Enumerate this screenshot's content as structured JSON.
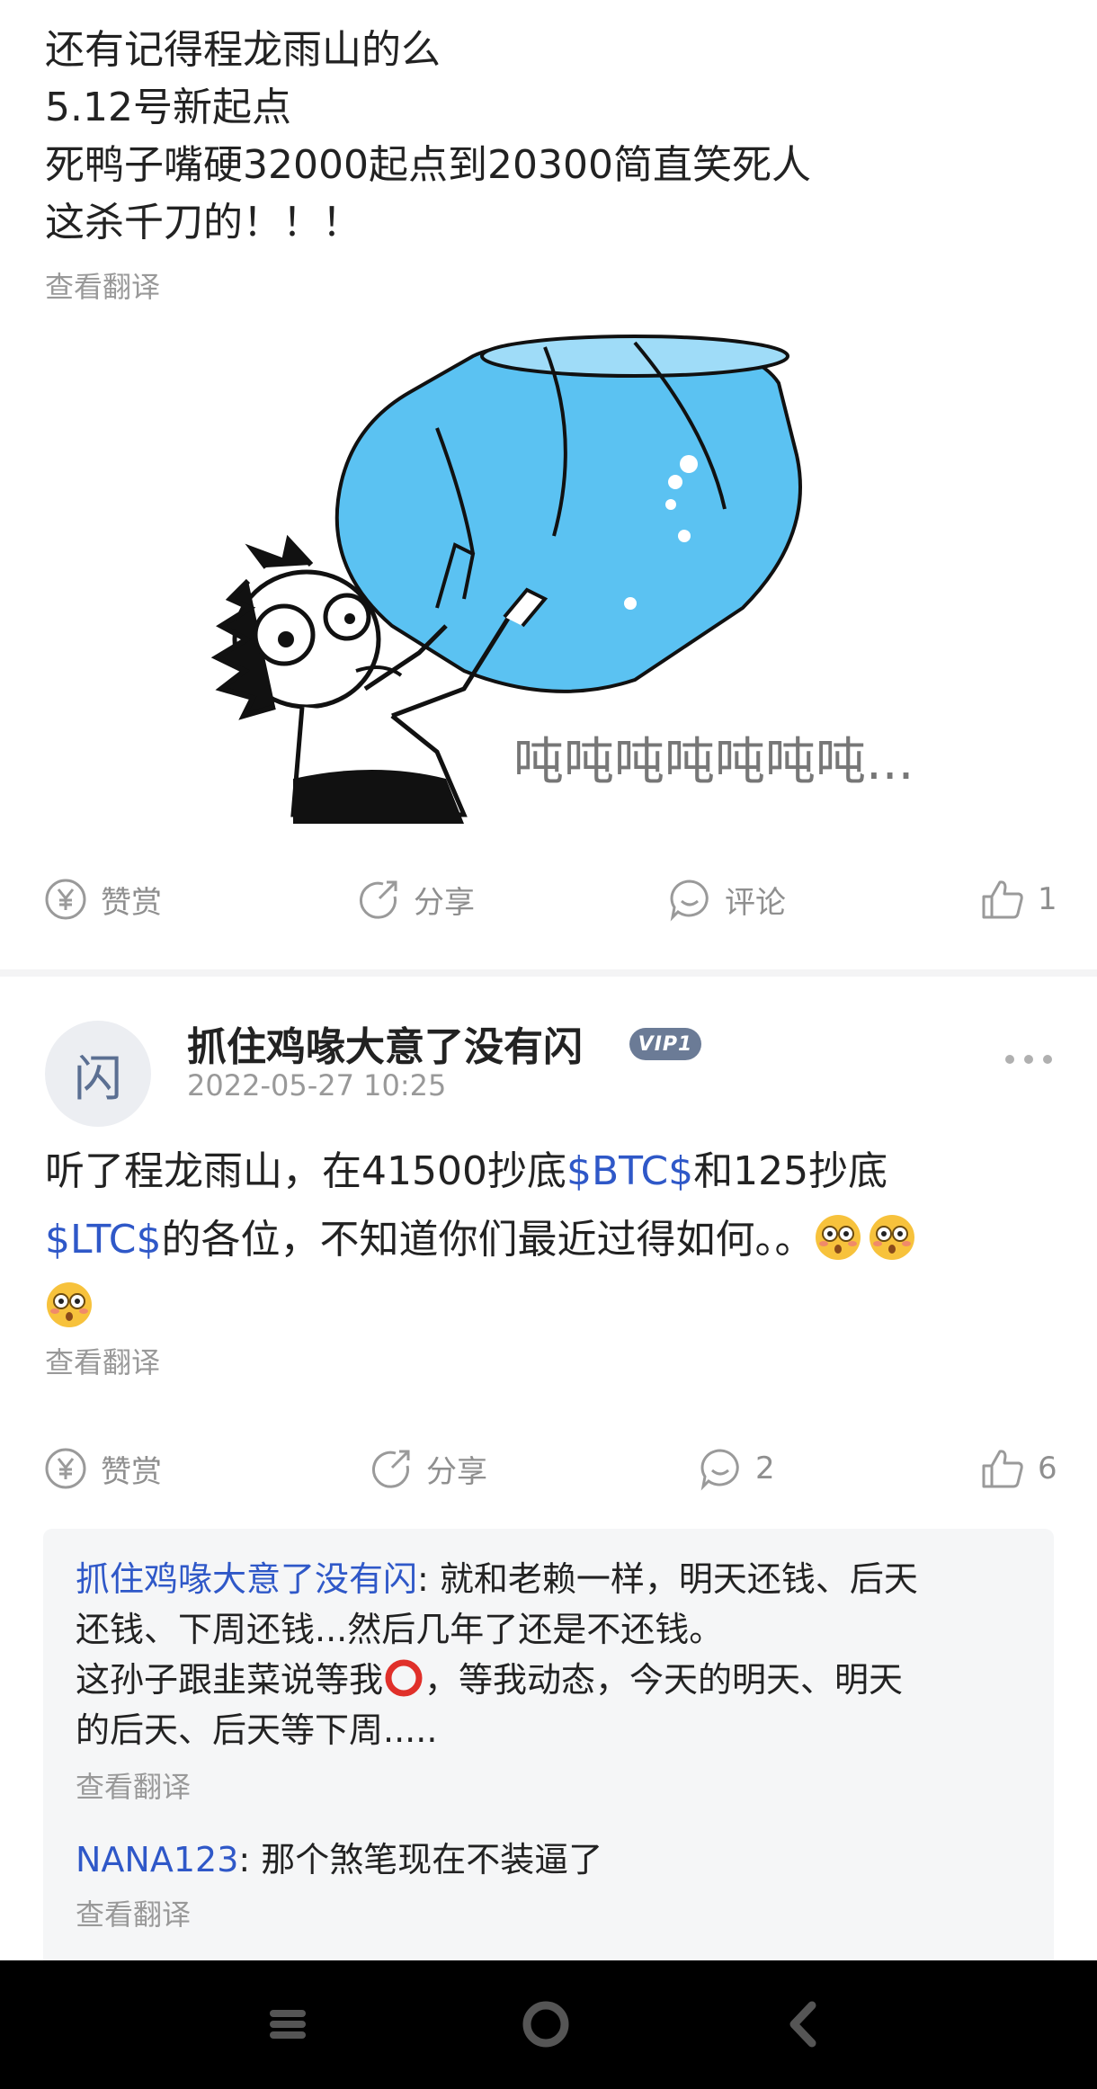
{
  "post1": {
    "lines": [
      "还有记得程龙雨山的么",
      "5.12号新起点",
      "死鸭子嘴硬32000起点到20300简直笑死人",
      "这杀千刀的！！！"
    ],
    "translate": "查看翻译",
    "meme_caption": "吨吨吨吨吨吨吨...",
    "actions": {
      "reward": "赞赏",
      "share": "分享",
      "comment": "评论",
      "like_count": "1"
    }
  },
  "post2": {
    "avatar_char": "闪",
    "username": "抓住鸡喙大意了没有闪",
    "vip_badge": "VIP1",
    "timestamp": "2022-05-27 10:25",
    "body": {
      "p1": "听了程龙雨山，在41500抄底",
      "tag_btc": "$BTC$",
      "p2": "和125抄底",
      "tag_ltc": "$LTC$",
      "p3": "的各位，不知道你们最近过得如何。。"
    },
    "translate": "查看翻译",
    "actions": {
      "reward": "赞赏",
      "share": "分享",
      "comment_count": "2",
      "like_count": "6"
    },
    "comments": [
      {
        "author": "抓住鸡喙大意了没有闪",
        "line1": ": 就和老赖一样，明天还钱、后天",
        "line2": "还钱、下周还钱...然后几年了还是不还钱。",
        "line3a": "这孙子跟韭菜说等我",
        "line3b": "，等我动态，今天的明天、明天",
        "line4": "的后天、后天等下周.....",
        "translate": "查看翻译"
      },
      {
        "author": "NANA123",
        "text": ": 那个煞笔现在不装逼了",
        "translate": "查看翻译"
      }
    ]
  },
  "colors": {
    "link_blue": "#2f58c8",
    "meme_water": "#5bc2f2",
    "icon_gray": "#8f8f8f",
    "nav_bg": "#000000"
  },
  "icons": [
    "yen-circle-icon",
    "share-arrow-icon",
    "comment-bubble-icon",
    "thumbs-up-icon",
    "more-dots-icon",
    "menu-icon",
    "home-circle-icon",
    "back-icon",
    "flushed-emoji-icon",
    "red-circle-emoji-icon"
  ]
}
